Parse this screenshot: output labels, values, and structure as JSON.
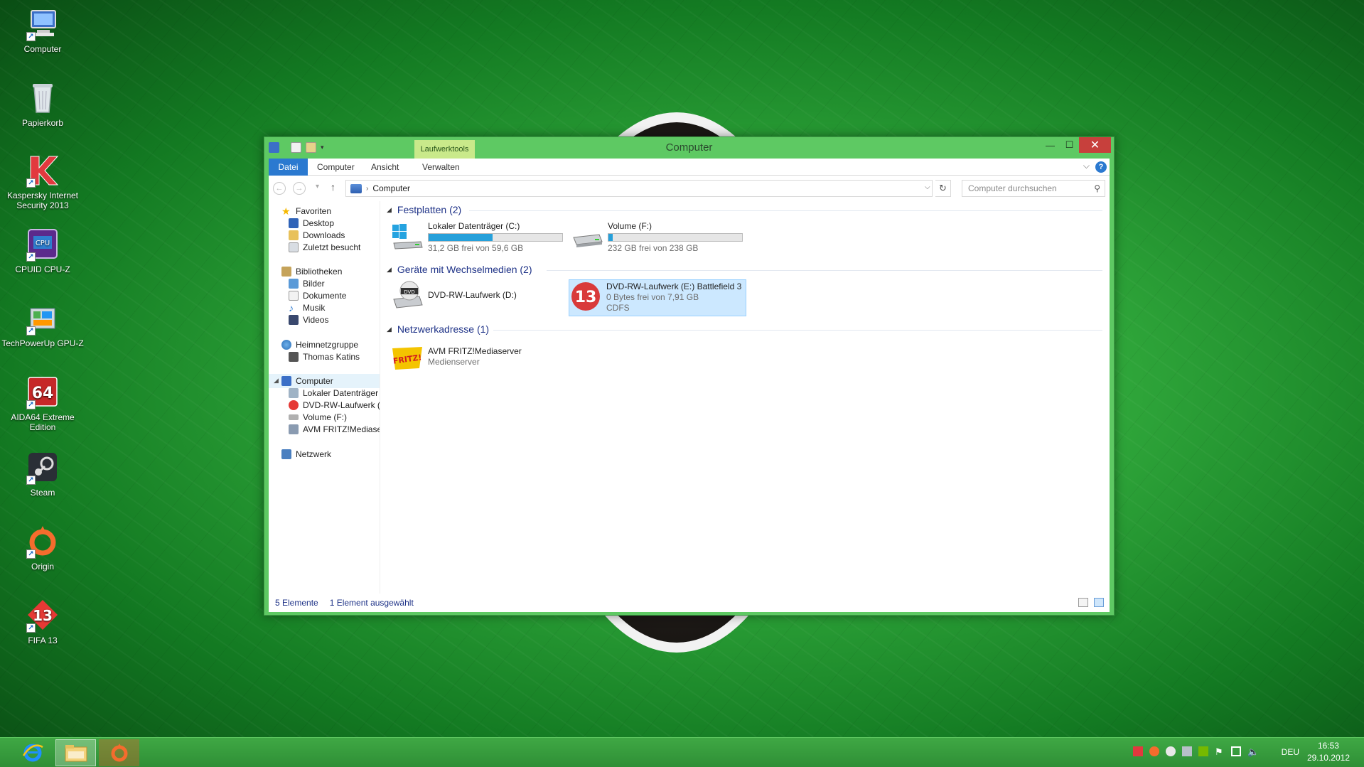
{
  "desktop": {
    "icons": [
      {
        "label": "Computer"
      },
      {
        "label": "Papierkorb"
      },
      {
        "label": "Kaspersky Internet Security 2013"
      },
      {
        "label": "CPUID CPU-Z"
      },
      {
        "label": "TechPowerUp GPU-Z"
      },
      {
        "label": "AIDA64 Extreme Edition"
      },
      {
        "label": "Steam"
      },
      {
        "label": "Origin"
      },
      {
        "label": "FIFA 13"
      }
    ]
  },
  "window": {
    "title": "Computer",
    "context_tab": "Laufwerktools",
    "ribbon_tabs": [
      "Datei",
      "Computer",
      "Ansicht",
      "Verwalten"
    ],
    "help": "?",
    "address": {
      "path": "Computer",
      "search_placeholder": "Computer durchsuchen"
    },
    "nav": {
      "favorites": "Favoriten",
      "desktop": "Desktop",
      "downloads": "Downloads",
      "recent": "Zuletzt besucht",
      "libraries": "Bibliotheken",
      "pictures": "Bilder",
      "documents": "Dokumente",
      "music": "Musik",
      "videos": "Videos",
      "homegroup": "Heimnetzgruppe",
      "user": "Thomas Katins",
      "computer": "Computer",
      "local_disk": "Lokaler Datenträger",
      "dvd": "DVD-RW-Laufwerk (",
      "volume": "Volume (F:)",
      "fritz": "AVM FRITZ!Mediase",
      "network": "Netzwerk"
    },
    "groups": {
      "hard_disks": "Festplatten (2)",
      "removable": "Geräte mit Wechselmedien (2)",
      "network": "Netzwerkadresse (1)"
    },
    "drives": {
      "c": {
        "name": "Lokaler Datenträger (C:)",
        "free": "31,2 GB frei von 59,6 GB",
        "used_fraction": 0.48
      },
      "f": {
        "name": "Volume (F:)",
        "free": "232 GB frei von 238 GB",
        "used_fraction": 0.03
      },
      "d": {
        "name": "DVD-RW-Laufwerk (D:)"
      },
      "e": {
        "name": "DVD-RW-Laufwerk (E:) Battlefield 3",
        "free": "0 Bytes frei von 7,91 GB",
        "fs": "CDFS"
      },
      "fritz": {
        "name": "AVM FRITZ!Mediaserver",
        "type": "Medienserver"
      }
    },
    "status": {
      "count": "5 Elemente",
      "selected": "1 Element ausgewählt"
    }
  },
  "taskbar": {
    "language": "DEU",
    "time": "16:53",
    "date": "29.10.2012"
  },
  "colors": {
    "accent": "#2b79d0",
    "window_frame": "#5ec963",
    "close": "#c7403c",
    "group_header": "#1e3287",
    "selection": "#cce8ff"
  }
}
